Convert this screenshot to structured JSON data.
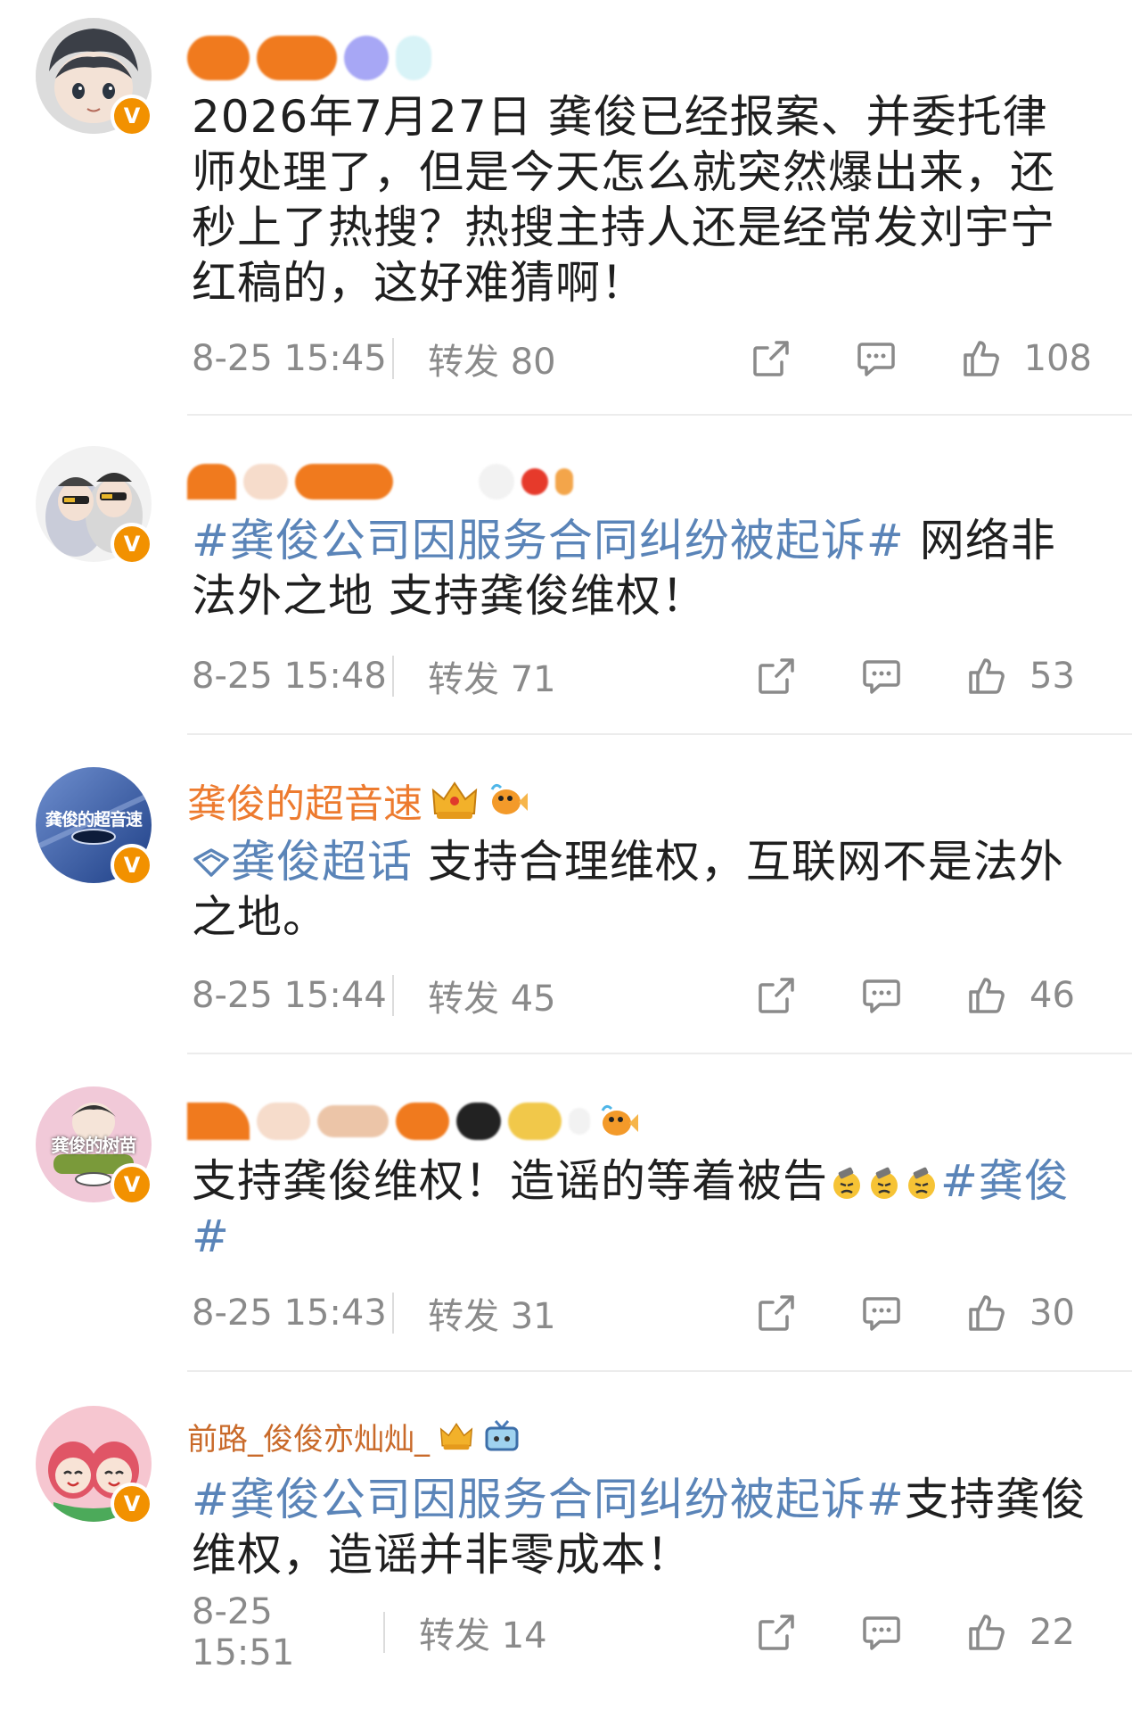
{
  "comments": [
    {
      "name": "",
      "text": "2026年7月27日 龚俊已经报案、并委托律师处理了，但是今天怎么就突然爆出来，还秒上了热搜？热搜主持人还是经常发刘宇宁红稿的，这好难猜啊！",
      "hashtag": "",
      "time": "8-25 15:45",
      "repost": "转发 80",
      "likes": "108"
    },
    {
      "name": "",
      "hashtag": "#龚俊公司因服务合同纠纷被起诉#",
      "text": " 网络非法外之地 支持龚俊维权！",
      "time": "8-25 15:48",
      "repost": "转发 71",
      "likes": "53"
    },
    {
      "name": "龚俊的超音速",
      "avatar_text": "龚俊的超音速",
      "hashtag": "龚俊超话",
      "text": " 支持合理维权，互联网不是法外之地。",
      "time": "8-25 15:44",
      "repost": "转发 45",
      "likes": "46"
    },
    {
      "name": "",
      "avatar_text": "龚俊的树苗",
      "text": "支持龚俊维权！造谣的等着被告",
      "hashtag": "#龚俊#",
      "time": "8-25 15:43",
      "repost": "转发 31",
      "likes": "30"
    },
    {
      "name": "前路_俊俊亦灿灿_",
      "hashtag": "#龚俊公司因服务合同纠纷被起诉#",
      "text": "支持龚俊维权，造谣并非零成本！",
      "time": "8-25 15:51",
      "repost": "转发 14",
      "likes": "22"
    }
  ],
  "colors": {
    "name": "#ed7b2f",
    "tag": "#5a84b8",
    "meta": "#8a8a8a",
    "badge": "#f29100"
  }
}
